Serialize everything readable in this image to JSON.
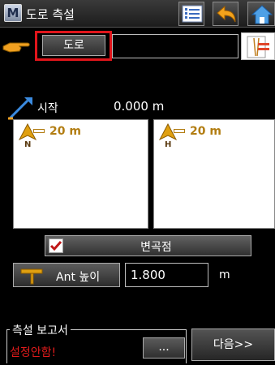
{
  "window": {
    "title": "도로 측설",
    "app_icon_letter": "M",
    "icons": [
      "list-icon",
      "back-icon",
      "home-icon"
    ]
  },
  "road": {
    "button_label": "도로",
    "field_value": "",
    "list_icon": "road-list-icon",
    "highlight_color": "#e0151b"
  },
  "start": {
    "label": "시작",
    "value": "0.000 m"
  },
  "maps": {
    "north_view": {
      "scale": "20 m",
      "direction_letter": "N"
    },
    "heading_view": {
      "scale": "20 m",
      "direction_letter": "H"
    }
  },
  "vertex": {
    "label": "변곡점",
    "checked": true
  },
  "antenna": {
    "label": "Ant 높이",
    "value": "1.800",
    "unit": "m"
  },
  "report": {
    "legend": "측설 보고서",
    "status": "설정안함!",
    "status_color": "#e01b1b",
    "browse_label": "...",
    "next_label": "다음>>"
  }
}
